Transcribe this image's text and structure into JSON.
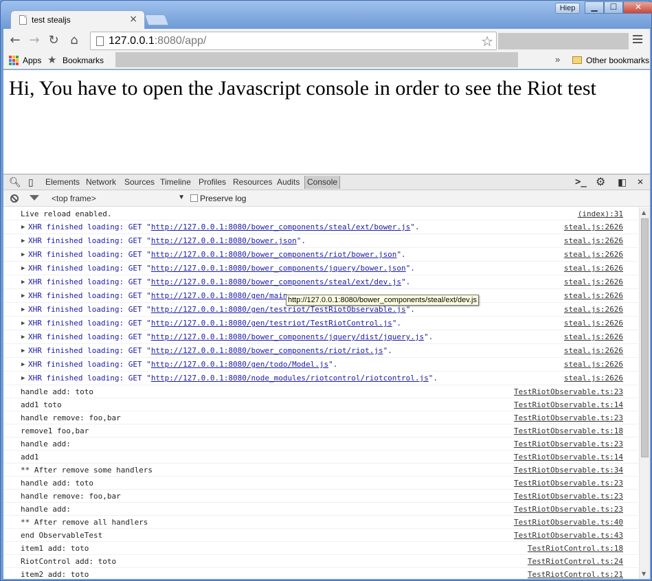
{
  "window": {
    "user_badge": "Hiep",
    "buttons": {
      "minimize": "▁",
      "maximize": "☐",
      "close": "✕"
    }
  },
  "tab": {
    "title": "test stealjs",
    "close": "×"
  },
  "toolbar": {
    "url_host": "127.0.0.1",
    "url_rest": ":8080/app/",
    "back": "←",
    "forward": "→",
    "reload": "↻",
    "home": "⌂",
    "star": "☆"
  },
  "bookmarks": {
    "apps_label": "Apps",
    "bookmarks_label": "Bookmarks",
    "overflow": "»",
    "other_label": "Other bookmarks",
    "apps_colors": [
      "#e84335",
      "#fbbc05",
      "#34a853",
      "#4285f4",
      "#ea4335",
      "#fbbc05",
      "#34a853",
      "#4285f4",
      "#e84335"
    ]
  },
  "page": {
    "heading": "Hi, You have to open the Javascript console in order to see the Riot test"
  },
  "devtools": {
    "tabs": [
      "Elements",
      "Network",
      "Sources",
      "Timeline",
      "Profiles",
      "Resources",
      "Audits",
      "Console"
    ],
    "active_tab": "Console",
    "frame_select": "<top frame>",
    "preserve_log": "Preserve log",
    "tooltip": "http://127.0.0.1:8080/bower_components/steal/ext/dev.js",
    "console_rows": [
      {
        "type": "log",
        "text": "Live reload enabled.",
        "src": "(index):31"
      },
      {
        "type": "xhr",
        "prefix": "XHR finished loading: GET \"",
        "url": "http://127.0.0.1:8080/bower_components/steal/ext/bower.js",
        "suffix": "\".",
        "src": "steal.js:2626"
      },
      {
        "type": "xhr",
        "prefix": "XHR finished loading: GET \"",
        "url": "http://127.0.0.1:8080/bower.json",
        "suffix": "\".",
        "src": "steal.js:2626"
      },
      {
        "type": "xhr",
        "prefix": "XHR finished loading: GET \"",
        "url": "http://127.0.0.1:8080/bower_components/riot/bower.json",
        "suffix": "\".",
        "src": "steal.js:2626"
      },
      {
        "type": "xhr",
        "prefix": "XHR finished loading: GET \"",
        "url": "http://127.0.0.1:8080/bower_components/jquery/bower.json",
        "suffix": "\".",
        "src": "steal.js:2626"
      },
      {
        "type": "xhr",
        "prefix": "XHR finished loading: GET \"",
        "url": "http://127.0.0.1:8080/bower_components/steal/ext/dev.js",
        "suffix": "\".",
        "src": "steal.js:2626"
      },
      {
        "type": "xhr",
        "prefix": "XHR finished loading: GET \"",
        "url": "http://127.0.0.1:8080/gen/main",
        "suffix": "",
        "src": "steal.js:2626"
      },
      {
        "type": "xhr",
        "prefix": "XHR finished loading: GET \"",
        "url": "http://127.0.0.1:8080/gen/testriot/TestRiotObservable.js",
        "suffix": "\".",
        "src": "steal.js:2626"
      },
      {
        "type": "xhr",
        "prefix": "XHR finished loading: GET \"",
        "url": "http://127.0.0.1:8080/gen/testriot/TestRiotControl.js",
        "suffix": "\".",
        "src": "steal.js:2626"
      },
      {
        "type": "xhr",
        "prefix": "XHR finished loading: GET \"",
        "url": "http://127.0.0.1:8080/bower_components/jquery/dist/jquery.js",
        "suffix": "\".",
        "src": "steal.js:2626"
      },
      {
        "type": "xhr",
        "prefix": "XHR finished loading: GET \"",
        "url": "http://127.0.0.1:8080/bower_components/riot/riot.js",
        "suffix": "\".",
        "src": "steal.js:2626"
      },
      {
        "type": "xhr",
        "prefix": "XHR finished loading: GET \"",
        "url": "http://127.0.0.1:8080/gen/todo/Model.js",
        "suffix": "\".",
        "src": "steal.js:2626"
      },
      {
        "type": "xhr",
        "prefix": "XHR finished loading: GET \"",
        "url": "http://127.0.0.1:8080/node_modules/riotcontrol/riotcontrol.js",
        "suffix": "\".",
        "src": "steal.js:2626"
      },
      {
        "type": "log",
        "text": "handle add: toto",
        "src": "TestRiotObservable.ts:23"
      },
      {
        "type": "log",
        "text": "add1 toto",
        "src": "TestRiotObservable.ts:14"
      },
      {
        "type": "log",
        "text": "handle remove: foo,bar",
        "src": "TestRiotObservable.ts:23"
      },
      {
        "type": "log",
        "text": "remove1 foo,bar",
        "src": "TestRiotObservable.ts:18"
      },
      {
        "type": "log",
        "text": "handle add:",
        "src": "TestRiotObservable.ts:23"
      },
      {
        "type": "log",
        "text": "add1",
        "src": "TestRiotObservable.ts:14"
      },
      {
        "type": "log",
        "text": "** After remove some handlers",
        "src": "TestRiotObservable.ts:34"
      },
      {
        "type": "log",
        "text": "handle add: toto",
        "src": "TestRiotObservable.ts:23"
      },
      {
        "type": "log",
        "text": "handle remove: foo,bar",
        "src": "TestRiotObservable.ts:23"
      },
      {
        "type": "log",
        "text": "handle add:",
        "src": "TestRiotObservable.ts:23"
      },
      {
        "type": "log",
        "text": "** After remove all handlers",
        "src": "TestRiotObservable.ts:40"
      },
      {
        "type": "log",
        "text": "end ObservableTest",
        "src": "TestRiotObservable.ts:43"
      },
      {
        "type": "log",
        "text": "item1 add: toto",
        "src": "TestRiotControl.ts:18"
      },
      {
        "type": "log",
        "text": "RiotControl add: toto",
        "src": "TestRiotControl.ts:24"
      },
      {
        "type": "log",
        "text": "item2 add: toto",
        "src": "TestRiotControl.ts:21"
      }
    ]
  }
}
